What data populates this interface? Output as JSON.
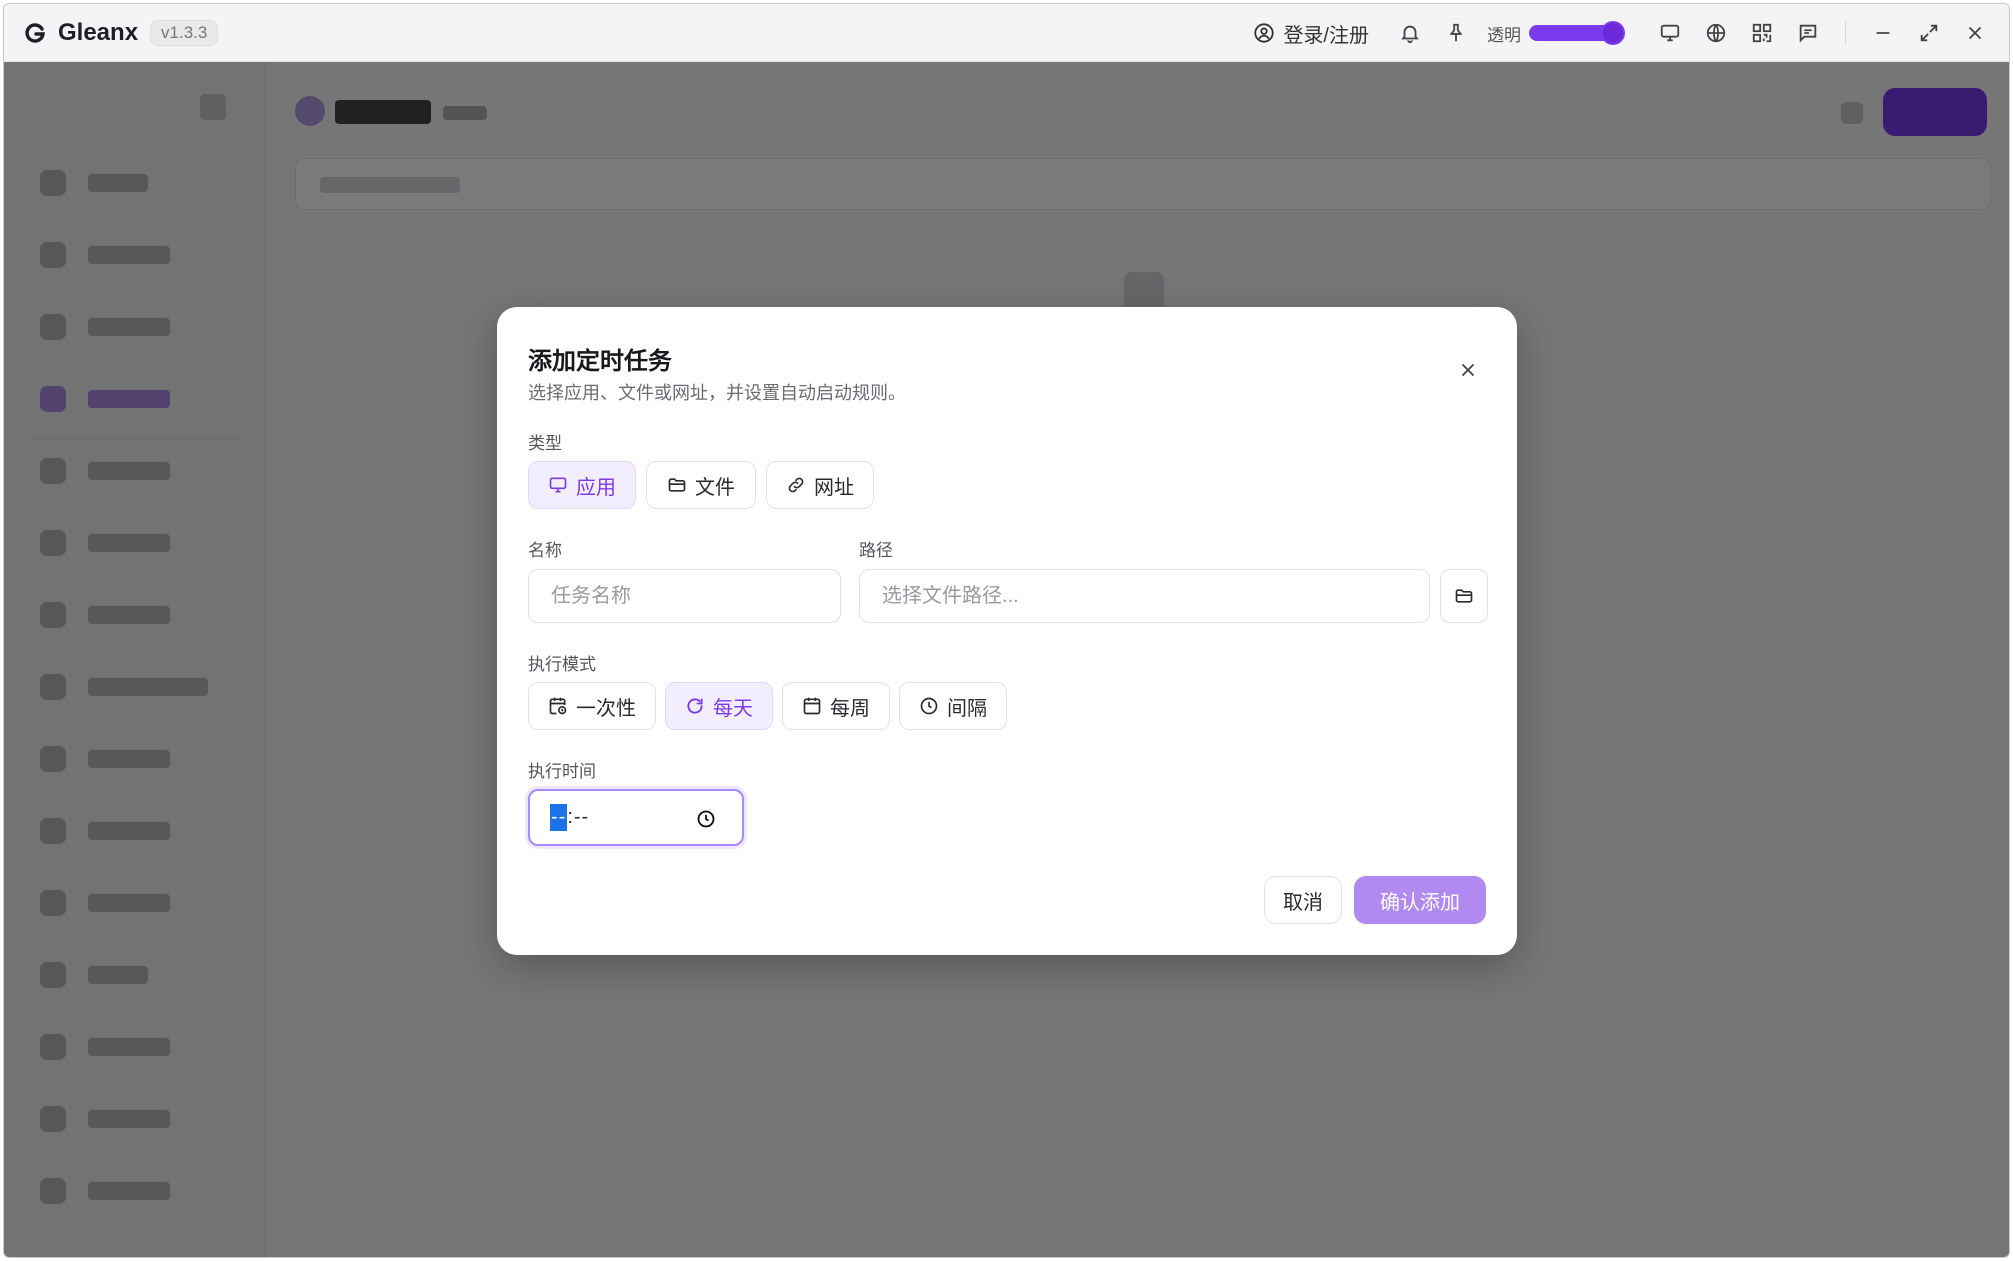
{
  "titlebar": {
    "app_name": "Gleanx",
    "version": "v1.3.3",
    "login_label": "登录/注册",
    "opacity_label": "透明",
    "opacity_value": 1.0
  },
  "modal": {
    "title": "添加定时任务",
    "description": "选择应用、文件或网址，并设置自动启动规则。",
    "type_label": "类型",
    "type_options": [
      {
        "label": "应用",
        "icon": "monitor-icon",
        "selected": true
      },
      {
        "label": "文件",
        "icon": "folder-icon",
        "selected": false
      },
      {
        "label": "网址",
        "icon": "link-icon",
        "selected": false
      }
    ],
    "name_label": "名称",
    "name_placeholder": "任务名称",
    "path_label": "路径",
    "path_placeholder": "选择文件路径...",
    "mode_label": "执行模式",
    "mode_options": [
      {
        "label": "一次性",
        "icon": "calendar-clock-icon",
        "selected": false
      },
      {
        "label": "每天",
        "icon": "refresh-icon",
        "selected": true
      },
      {
        "label": "每周",
        "icon": "calendar-icon",
        "selected": false
      },
      {
        "label": "间隔",
        "icon": "clock-icon",
        "selected": false
      }
    ],
    "time_label": "执行时间",
    "time_hour": "--",
    "time_rest": ":--",
    "cancel_label": "取消",
    "confirm_label": "确认添加"
  },
  "colors": {
    "accent": "#7c3aed",
    "accent_soft": "#b08af0",
    "selected_bg": "#f3eefe",
    "overlay": "rgba(0,0,0,0.52)"
  }
}
